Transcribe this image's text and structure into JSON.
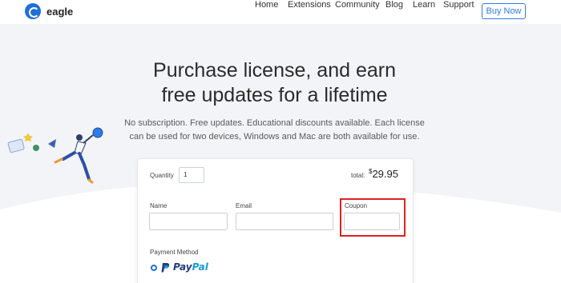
{
  "nav": {
    "brand": "eagle",
    "links": [
      "Home",
      "Extensions",
      "Community",
      "Blog",
      "Learn",
      "Support"
    ],
    "cta": "Buy Now"
  },
  "hero": {
    "title_line1": "Purchase license, and earn",
    "title_line2": "free updates for a lifetime",
    "subtitle_line1": "No subscription. Free updates. Educational discounts available. Each license",
    "subtitle_line2": "can be used for two devices, Windows and Mac are both available for use."
  },
  "form": {
    "quantity_label": "Quantity",
    "quantity_value": "1",
    "total_label": "total:",
    "currency": "$",
    "total_value": "29.95",
    "name_label": "Name",
    "name_value": "",
    "email_label": "Email",
    "email_value": "",
    "coupon_label": "Coupon",
    "coupon_value": "",
    "payment_label": "Payment Method",
    "payment_option_a": "Pay",
    "payment_option_b": "Pal"
  },
  "colors": {
    "accent": "#2f7be8",
    "highlight": "#e02020",
    "background": "#f3f4f7"
  },
  "icons": [
    "eagle-logo-icon",
    "paypal-icon",
    "radio-selected-icon",
    "illustration-person-globe"
  ]
}
